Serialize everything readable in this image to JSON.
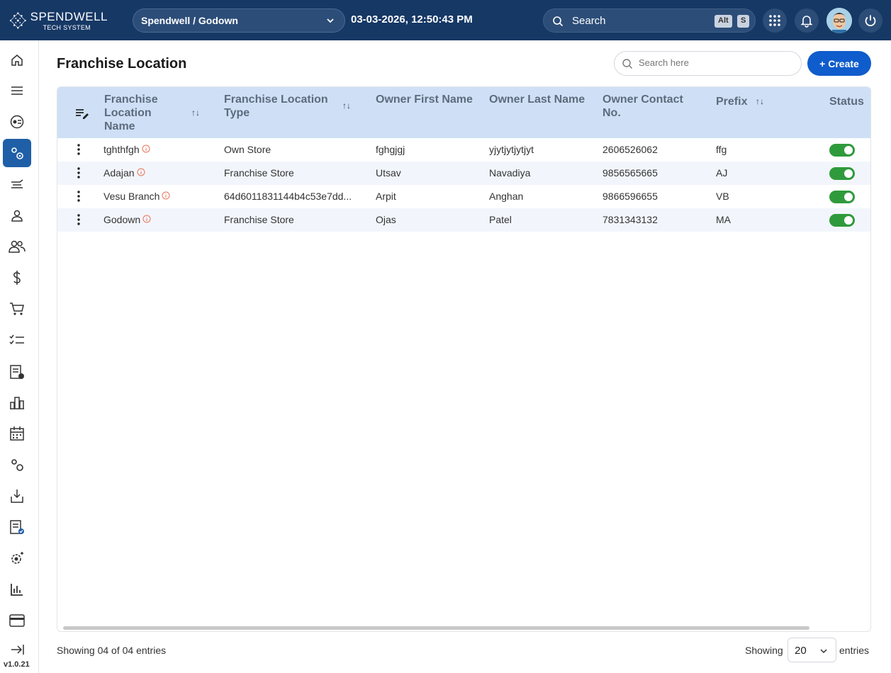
{
  "header": {
    "logo_line1": "SPENDWELL",
    "logo_line2": "TECH SYSTEM",
    "org_selected": "Spendwell / Godown",
    "datetime": "03-03-2026, 12:50:43 PM",
    "search_label": "Search",
    "shortcut_keys": [
      "Alt",
      "S"
    ]
  },
  "sidebar": {
    "items": [
      {
        "icon": "home-icon"
      },
      {
        "icon": "menu-icon"
      },
      {
        "icon": "dashboard-gauge-icon"
      },
      {
        "icon": "settings-cogs-icon",
        "active": true
      },
      {
        "icon": "delivery-icon"
      },
      {
        "icon": "user-icon"
      },
      {
        "icon": "users-icon"
      },
      {
        "icon": "dollar-icon"
      },
      {
        "icon": "cart-icon"
      },
      {
        "icon": "checklist-icon"
      },
      {
        "icon": "report-icon"
      },
      {
        "icon": "building-chart-icon"
      },
      {
        "icon": "calendar-icon"
      },
      {
        "icon": "cogs-icon"
      },
      {
        "icon": "download-tray-icon"
      },
      {
        "icon": "approved-list-icon"
      },
      {
        "icon": "gear-sparkle-icon"
      },
      {
        "icon": "bar-chart-icon"
      },
      {
        "icon": "card-icon"
      },
      {
        "icon": "logout-icon"
      }
    ],
    "version": "v1.0.21"
  },
  "main": {
    "title": "Franchise Location",
    "search_placeholder": "Search here",
    "create_label": "+ Create",
    "columns": [
      {
        "label": "Franchise Location Name",
        "sortable": true
      },
      {
        "label": "Franchise Location Type",
        "sortable": true
      },
      {
        "label": "Owner First Name",
        "sortable": false
      },
      {
        "label": "Owner Last Name",
        "sortable": false
      },
      {
        "label": "Owner Contact No.",
        "sortable": false
      },
      {
        "label": "Prefix",
        "sortable": true
      },
      {
        "label": "Status",
        "sortable": false
      }
    ],
    "rows": [
      {
        "name": "tghthfgh",
        "type": "Own Store",
        "first": "fghgjgj",
        "last": "yjytjytjytjyt",
        "contact": "2606526062",
        "prefix": "ffg",
        "status": true
      },
      {
        "name": "Adajan",
        "type": "Franchise Store",
        "first": "Utsav",
        "last": "Navadiya",
        "contact": "9856565665",
        "prefix": "AJ",
        "status": true
      },
      {
        "name": "Vesu Branch",
        "type": "64d6011831144b4c53e7dd...",
        "first": "Arpit",
        "last": "Anghan",
        "contact": "9866596655",
        "prefix": "VB",
        "status": true
      },
      {
        "name": "Godown",
        "type": "Franchise Store",
        "first": "Ojas",
        "last": "Patel",
        "contact": "7831343132",
        "prefix": "MA",
        "status": true
      }
    ]
  },
  "footer": {
    "summary": "Showing 04 of 04 entries",
    "showing_label": "Showing",
    "page_size": "20",
    "entries_label": "entries"
  },
  "colors": {
    "topbar": "#163865",
    "accent": "#0f5ccc",
    "header_row": "#cfe0f6",
    "toggle_on": "#2f9a3c",
    "info_icon": "#e8735a"
  }
}
